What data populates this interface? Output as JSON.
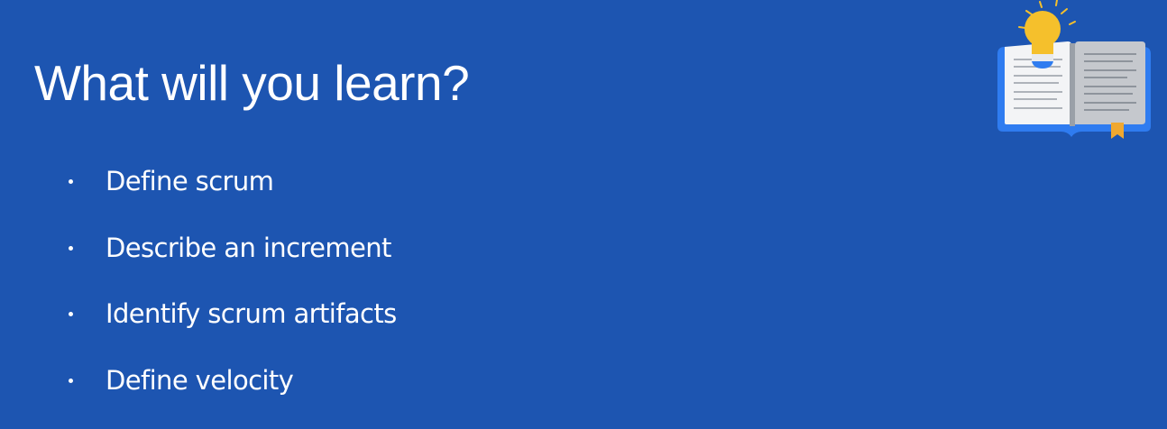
{
  "slide": {
    "title": "What will you learn?",
    "bullets": [
      {
        "label": "Define scrum"
      },
      {
        "label": "Describe an increment"
      },
      {
        "label": "Identify scrum artifacts"
      },
      {
        "label": "Define velocity"
      }
    ],
    "illustration": {
      "icon": "book-with-lightbulb-icon"
    }
  },
  "colors": {
    "background": "#1d55b1",
    "text": "#ffffff",
    "bulb": "#f5c02c",
    "book_cover": "#2f7cf0",
    "page_left": "#f3f4f6",
    "page_right": "#c5c8cd",
    "bookmark": "#f0a830"
  }
}
